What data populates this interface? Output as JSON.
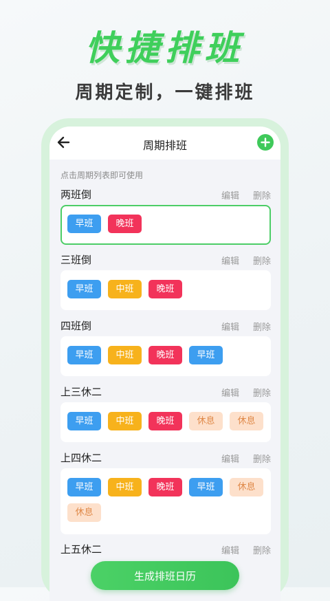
{
  "hero": {
    "title": "快捷排班",
    "subtitle": "周期定制，一键排班"
  },
  "nav": {
    "title": "周期排班",
    "back_icon": "arrow-left-icon",
    "add_icon": "plus-circle-icon"
  },
  "hint": "点击周期列表即可使用",
  "actions": {
    "edit": "编辑",
    "delete": "删除"
  },
  "colors": {
    "morning": "#3d9ef0",
    "middle": "#f7b21c",
    "night": "#f2335a",
    "rest": "#fde0cb",
    "accent": "#3fc95a"
  },
  "groups": [
    {
      "name": "两班倒",
      "selected": true,
      "chips": [
        {
          "label": "早班",
          "type": "morning"
        },
        {
          "label": "晚班",
          "type": "night"
        }
      ]
    },
    {
      "name": "三班倒",
      "chips": [
        {
          "label": "早班",
          "type": "morning"
        },
        {
          "label": "中班",
          "type": "middle"
        },
        {
          "label": "晚班",
          "type": "night"
        }
      ]
    },
    {
      "name": "四班倒",
      "chips": [
        {
          "label": "早班",
          "type": "morning"
        },
        {
          "label": "中班",
          "type": "middle"
        },
        {
          "label": "晚班",
          "type": "night"
        },
        {
          "label": "早班",
          "type": "morning"
        }
      ]
    },
    {
      "name": "上三休二",
      "chips": [
        {
          "label": "早班",
          "type": "morning"
        },
        {
          "label": "中班",
          "type": "middle"
        },
        {
          "label": "晚班",
          "type": "night"
        },
        {
          "label": "休息",
          "type": "rest"
        },
        {
          "label": "休息",
          "type": "rest"
        }
      ]
    },
    {
      "name": "上四休二",
      "chips": [
        {
          "label": "早班",
          "type": "morning"
        },
        {
          "label": "中班",
          "type": "middle"
        },
        {
          "label": "晚班",
          "type": "night"
        },
        {
          "label": "早班",
          "type": "morning"
        },
        {
          "label": "休息",
          "type": "rest"
        },
        {
          "label": "休息",
          "type": "rest"
        }
      ]
    },
    {
      "name": "上五休二",
      "chips": []
    }
  ],
  "generate_button": "生成排班日历"
}
